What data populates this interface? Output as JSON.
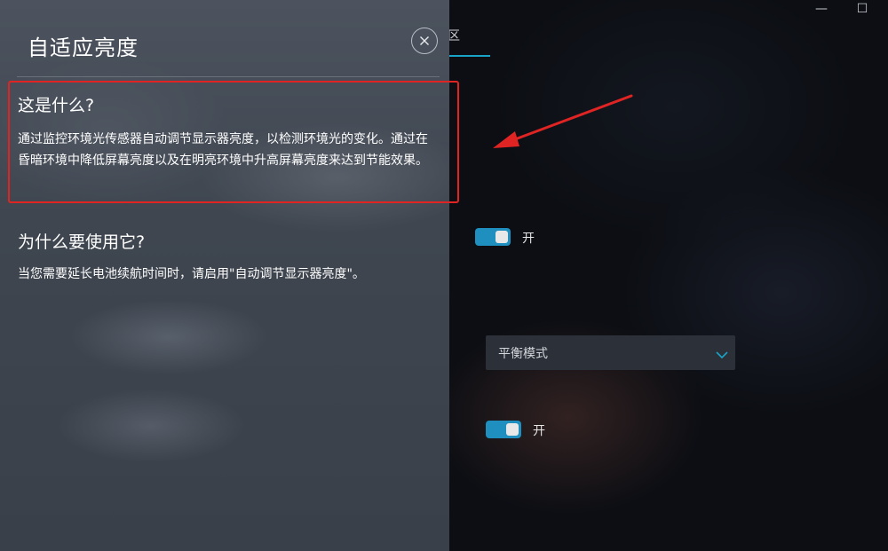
{
  "window": {
    "minimize_glyph": "—",
    "maximize_glyph": "☐"
  },
  "background_app": {
    "tab_partial_label": "区",
    "toggle1_label": "开",
    "toggle2_label": "开",
    "dropdown_value": "平衡模式",
    "accent_color": "#1aa3c8"
  },
  "panel": {
    "title": "自适应亮度",
    "close_glyph": "×",
    "section1": {
      "heading": "这是什么?",
      "body": "通过监控环境光传感器自动调节显示器亮度，以检测环境光的变化。通过在昏暗环境中降低屏幕亮度以及在明亮环境中升高屏幕亮度来达到节能效果。"
    },
    "section2": {
      "heading": "为什么要使用它?",
      "body": "当您需要延长电池续航时间时，请启用\"自动调节显示器亮度\"。"
    }
  },
  "annotation_color": "#e02424"
}
